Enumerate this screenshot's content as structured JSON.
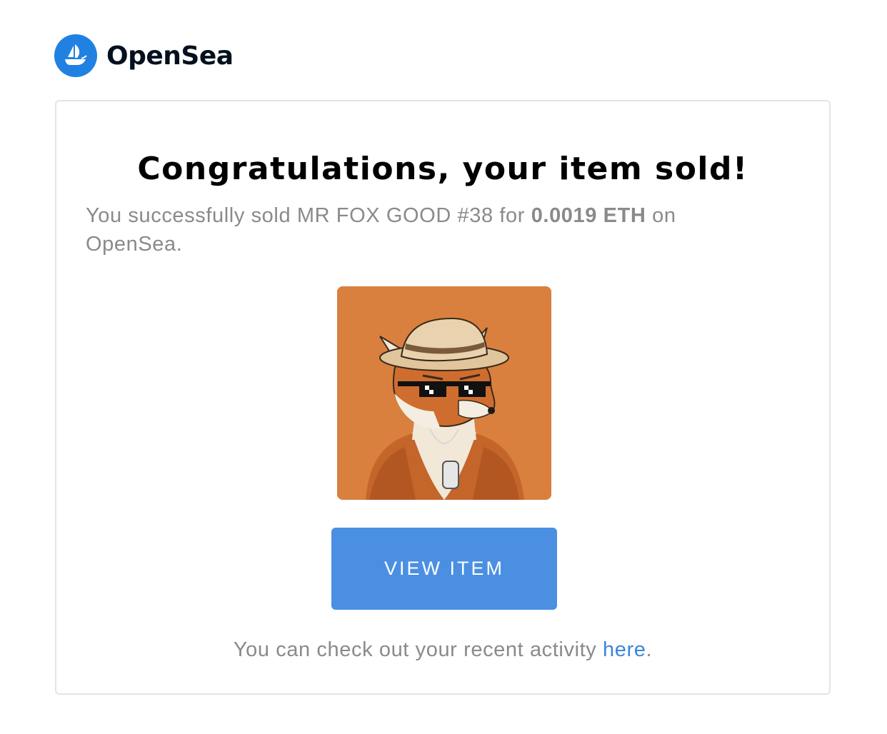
{
  "brand": {
    "name": "OpenSea",
    "logo_icon": "opensea-boat-icon",
    "color": "#2081e2"
  },
  "card": {
    "title": "Congratulations, your item sold!",
    "message": {
      "prefix": "You successfully sold MR FOX GOOD #38 for ",
      "amount": "0.0019 ETH",
      "suffix": " on OpenSea."
    },
    "item_image": {
      "icon": "fox-nft-artwork",
      "background_color": "#d9803e"
    },
    "button": {
      "label": "VIEW ITEM",
      "color": "#4a8fe2"
    },
    "footer": {
      "prefix": "You can check out your recent activity ",
      "link_text": "here",
      "suffix": "."
    }
  }
}
